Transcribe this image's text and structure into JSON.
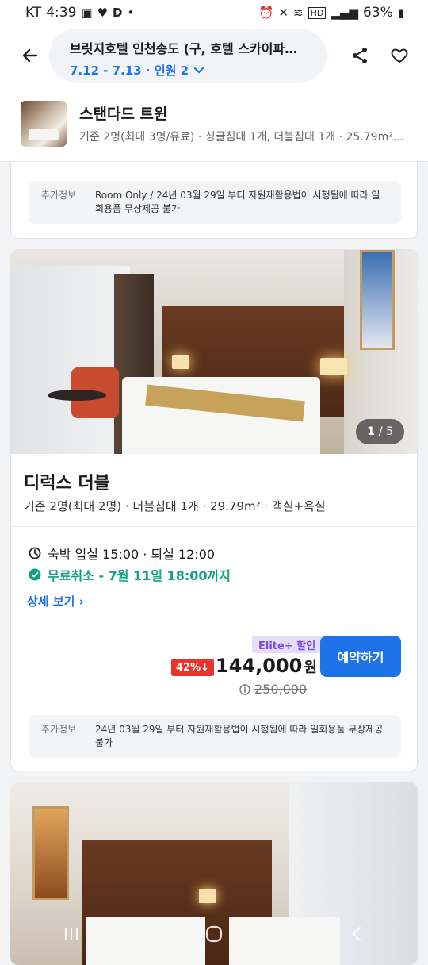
{
  "status_bar": {
    "carrier": "KT",
    "time": "4:39",
    "battery": "63%"
  },
  "header": {
    "hotel_name": "브릿지호텔 인천송도 (구, 호텔 스카이파크 ...",
    "search_summary": "7.12 - 7.13 · 인원 2"
  },
  "sticky_room": {
    "name": "스탠다드 트윈",
    "desc": "기준 2명(최대 3명/유료) · 싱글침대 1개, 더블침대 1개 · 25.79m²..."
  },
  "card_prev": {
    "extra_label": "추가정보",
    "extra_text": "Room Only / 24년 03월 29일 부터 자원재활용법이 시행됨에 따라 일회용품 무상제공 불가"
  },
  "room": {
    "photo_index": "1",
    "photo_total": "/ 5",
    "name": "디럭스 더블",
    "desc": "기준 2명(최대 2명) · 더블침대 1개 · 29.79m² · 객실+욕실",
    "stay": "숙박  입실 15:00 · 퇴실 12:00",
    "free_cancel": "무료취소 - 7월 11일 18:00까지",
    "details_link": "상세 보기",
    "elite_badge": "Elite+ 할인",
    "discount": "42%↓",
    "price": "144,000",
    "currency": "원",
    "original_price": "250,000",
    "book_button": "예약하기",
    "extra_label": "추가정보",
    "extra_text": "24년 03월 29일 부터 자원재활용법이 시행됨에 따라 일회용품 무상제공 불가"
  },
  "colors": {
    "accent": "#1e73e8",
    "free_cancel": "#12a085",
    "discount": "#e9342e",
    "elite": "#7c4ddf"
  }
}
